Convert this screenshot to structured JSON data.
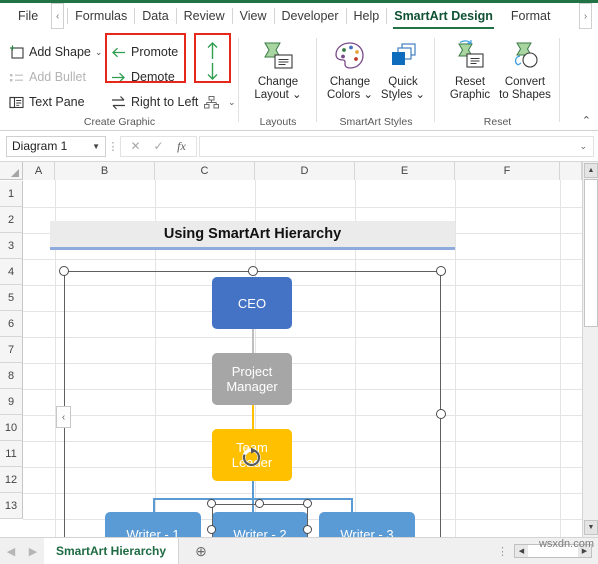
{
  "ribbon": {
    "tabs": [
      {
        "label": "File",
        "active": false
      },
      {
        "label": "Formulas",
        "active": false
      },
      {
        "label": "Data",
        "active": false
      },
      {
        "label": "Review",
        "active": false
      },
      {
        "label": "View",
        "active": false
      },
      {
        "label": "Developer",
        "active": false
      },
      {
        "label": "Help",
        "active": false
      },
      {
        "label": "SmartArt Design",
        "active": true
      },
      {
        "label": "Format",
        "active": false
      }
    ],
    "nav_left": "‹",
    "nav_right": "›",
    "collapse": "⌃",
    "groups": [
      {
        "name": "create-graphic",
        "label": "Create Graphic"
      },
      {
        "name": "layouts",
        "label": "Layouts"
      },
      {
        "name": "smartart-styles",
        "label": "SmartArt Styles"
      },
      {
        "name": "reset",
        "label": "Reset"
      }
    ],
    "create_graphic": {
      "add_shape": "Add Shape",
      "add_bullet": "Add Bullet",
      "text_pane": "Text Pane",
      "promote": "Promote",
      "demote": "Demote",
      "right_to_left": "Right to Left",
      "layout_caret": "⌄",
      "dropdown_caret": "⌄"
    },
    "layouts": {
      "change_layout_l1": "Change",
      "change_layout_l2": "Layout ⌄"
    },
    "styles": {
      "change_colors_l1": "Change",
      "change_colors_l2": "Colors ⌄",
      "quick_styles_l1": "Quick",
      "quick_styles_l2": "Styles ⌄"
    },
    "reset": {
      "reset_graphic_l1": "Reset",
      "reset_graphic_l2": "Graphic",
      "convert_l1": "Convert",
      "convert_l2": "to Shapes"
    },
    "highlight_color": "#e8271c"
  },
  "formula_bar": {
    "name_box": "Diagram 1",
    "name_caret": "▼",
    "cancel": "✕",
    "enter": "✓",
    "fx": "fx",
    "formula_value": "",
    "formula_placeholder": "",
    "expand_caret": "⌄"
  },
  "grid": {
    "columns": [
      "A",
      "B",
      "C",
      "D",
      "E",
      "F"
    ],
    "rows": [
      "1",
      "2",
      "3",
      "4",
      "5",
      "6",
      "7",
      "8",
      "9",
      "10",
      "11",
      "12",
      "13"
    ]
  },
  "sheet": {
    "title_banner": "Using SmartArt Hierarchy",
    "tab_name": "SmartArt Hierarchy",
    "add_sheet": "⊕",
    "nav_prev": "◀",
    "nav_next": "▶",
    "dots": "⋮",
    "watermark": "wsxdn.com"
  },
  "smartart": {
    "text_pane_toggle": "‹",
    "nodes": [
      {
        "id": "ceo",
        "label": "CEO",
        "color": "#4472c4",
        "level": 1
      },
      {
        "id": "project-manager",
        "label": "Project\nManager",
        "color": "#a6a6a6",
        "level": 2
      },
      {
        "id": "team-leader",
        "label": "Team\nLeader",
        "color": "#ffc000",
        "level": 3
      },
      {
        "id": "writer-1",
        "label": "Writer - 1",
        "color": "#5b9bd5",
        "level": 4
      },
      {
        "id": "writer-2",
        "label": "Writer - 2",
        "color": "#5b9bd5",
        "level": 4,
        "selected": true
      },
      {
        "id": "writer-3",
        "label": "Writer - 3",
        "color": "#5b9bd5",
        "level": 4
      }
    ]
  }
}
